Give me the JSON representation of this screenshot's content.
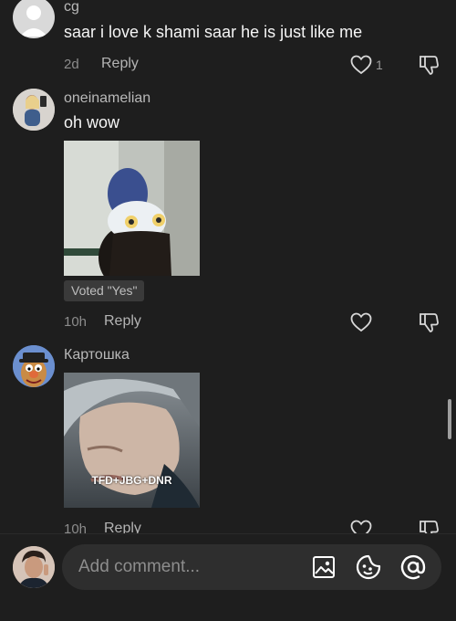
{
  "comments": [
    {
      "username": "cg",
      "text": "saar i love k shami saar he is just like me",
      "time": "2d",
      "reply_label": "Reply",
      "like_count": "1"
    },
    {
      "username": "oneinamelian",
      "text": "oh wow",
      "media_icon": "owl-sticker",
      "vote_badge": "Voted \"Yes\"",
      "time": "10h",
      "reply_label": "Reply"
    },
    {
      "username": "Картошка",
      "media_icon": "portrait-image",
      "media_caption": "TFD+JBG+DNR",
      "time": "10h",
      "reply_label": "Reply"
    }
  ],
  "composer": {
    "placeholder": "Add comment...",
    "icons": [
      "image-icon",
      "emoji-icon",
      "mention-icon"
    ]
  },
  "colors": {
    "background": "#1e1e1e",
    "input_background": "#2e2e2e",
    "text_primary": "#ffffff",
    "text_secondary": "#8c8c8c"
  }
}
